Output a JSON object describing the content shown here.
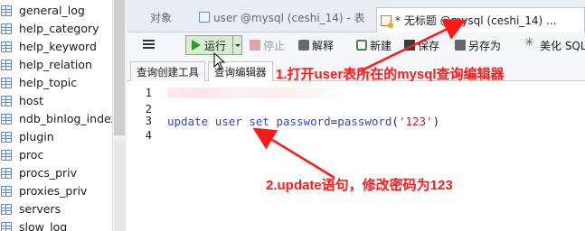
{
  "sidebar": {
    "items": [
      {
        "label": "general_log"
      },
      {
        "label": "help_category"
      },
      {
        "label": "help_keyword"
      },
      {
        "label": "help_relation"
      },
      {
        "label": "help_topic"
      },
      {
        "label": "host"
      },
      {
        "label": "ndb_binlog_index"
      },
      {
        "label": "plugin"
      },
      {
        "label": "proc"
      },
      {
        "label": "procs_priv"
      },
      {
        "label": "proxies_priv"
      },
      {
        "label": "servers"
      },
      {
        "label": "slow_log"
      }
    ],
    "icon": "table-icon"
  },
  "tabs": [
    {
      "label": "对象"
    },
    {
      "label": "user @mysql (ceshi_14) - 表",
      "icon": "table-icon"
    },
    {
      "label": "* 无标题 @mysql (ceshi_14) ...",
      "icon": "query-icon",
      "active": true
    }
  ],
  "toolbar": {
    "run_label": "运行",
    "stop_label": "停止",
    "explain_label": "解释",
    "new_label": "新建",
    "save_label": "保存",
    "saveas_label": "另存为",
    "beautify_label": "美化 SQL"
  },
  "subtabs": [
    {
      "label": "查询创建工具"
    },
    {
      "label": "查询编辑器",
      "active": true
    }
  ],
  "editor": {
    "line_numbers": [
      "1",
      "2",
      "3",
      "4"
    ],
    "code": {
      "kw1": "update",
      "ident": "user",
      "kw2": "set",
      "col": "password",
      "eq": "=",
      "fn": "password",
      "open": "(",
      "str": "'123'",
      "close": ")"
    }
  },
  "annotations": {
    "step1": "1.打开user表所在的mysql查询编辑器",
    "step2": "2.update语句，修改密码为123",
    "color": "#ff1a1a"
  },
  "colors": {
    "run_button_bg": "#d8ecd3",
    "keyword": "#3a46b8",
    "string": "#b3262a"
  }
}
